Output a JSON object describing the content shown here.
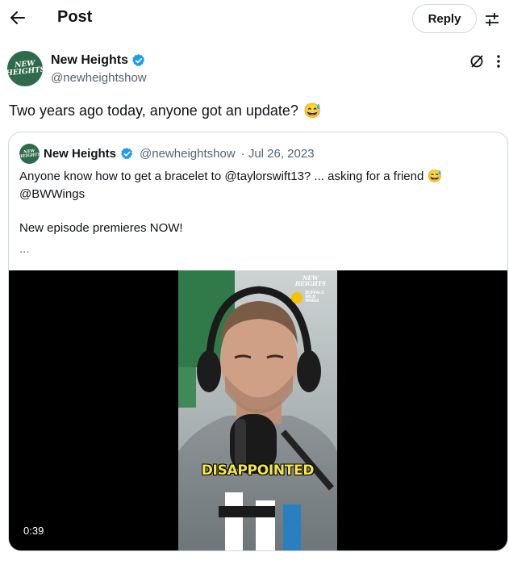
{
  "header": {
    "title": "Post",
    "reply_label": "Reply"
  },
  "post": {
    "author_name": "New Heights",
    "author_handle": "@newheightshow",
    "avatar_text": "NEW HEIGHTS",
    "text": "Two years ago today, anyone got an update?",
    "emoji": "😅"
  },
  "quote": {
    "author_name": "New Heights",
    "author_handle": "@newheightshow",
    "date": "· Jul 26, 2023",
    "line1": "Anyone know how to get a bracelet to @taylorswift13? ... asking for a friend",
    "line1_emoji": "😅",
    "line2": "@BWWings",
    "line3": "New episode premieres NOW!",
    "ellipsis": "...",
    "video": {
      "duration": "0:39",
      "caption": "DISAPPOINTED",
      "watermark_logo": "NEW HEIGHTS",
      "watermark_sponsor": "BUFFALO WILD WINGS"
    }
  },
  "colors": {
    "text_primary": "#0f1419",
    "text_secondary": "#536471",
    "verified_blue": "#1d9bf0",
    "border": "#cfd9de",
    "avatar_green": "#2f6a4a",
    "caption_yellow": "#f4e64a"
  },
  "icons": {
    "back": "arrow-left-icon",
    "settings": "sliders-icon",
    "verified": "verified-badge-icon",
    "grok": "grok-icon",
    "more": "more-vertical-icon"
  }
}
